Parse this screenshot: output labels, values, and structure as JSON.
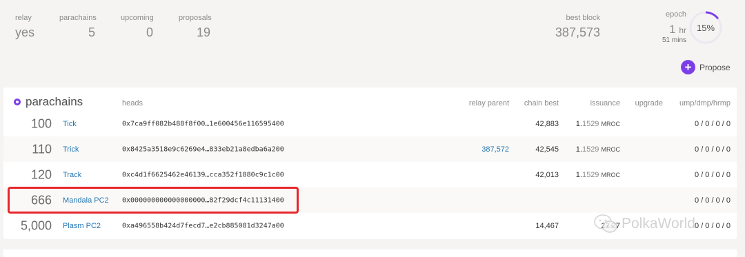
{
  "summary": {
    "relay": {
      "label": "relay",
      "value": "yes"
    },
    "parachains": {
      "label": "parachains",
      "value": "5"
    },
    "upcoming": {
      "label": "upcoming",
      "value": "0"
    },
    "proposals": {
      "label": "proposals",
      "value": "19"
    },
    "best_block": {
      "label": "best block",
      "value": "387,573"
    }
  },
  "epoch": {
    "label": "epoch",
    "hours": "1",
    "hours_unit": "hr",
    "minutes": "51 mins",
    "percent_label": "15%",
    "progress_fraction": 0.15
  },
  "propose_button": {
    "label": "Propose",
    "icon": "plus-icon"
  },
  "table": {
    "title": "parachains",
    "headers": {
      "heads": "heads",
      "relay_parent": "relay parent",
      "chain_best": "chain best",
      "issuance": "issuance",
      "upgrade": "upgrade",
      "ump": "ump/dmp/hrmp"
    },
    "rows": [
      {
        "id": "100",
        "name": "Tick",
        "head": "0x7ca9ff082b488f8f00…1e600456e116595400",
        "relay_parent": "",
        "chain_best": "42,883",
        "iss_int": "1.",
        "iss_frac": "1529",
        "iss_unit": "MROC",
        "ump": "0 / 0 / 0 / 0"
      },
      {
        "id": "110",
        "name": "Trick",
        "head": "0x8425a3518e9c6269e4…833eb21a8edba6a200",
        "relay_parent": "387,572",
        "chain_best": "42,545",
        "iss_int": "1.",
        "iss_frac": "1529",
        "iss_unit": "MROC",
        "ump": "0 / 0 / 0 / 0"
      },
      {
        "id": "120",
        "name": "Track",
        "head": "0xc4d1f6625462e46139…cca352f1880c9c1c00",
        "relay_parent": "",
        "chain_best": "42,013",
        "iss_int": "1.",
        "iss_frac": "1529",
        "iss_unit": "MROC",
        "ump": "0 / 0 / 0 / 0"
      },
      {
        "id": "666",
        "name": "Mandala PC2",
        "head": "0x000000000000000000…82f29dcf4c11131400",
        "relay_parent": "",
        "chain_best": "",
        "iss_int": "",
        "iss_frac": "",
        "iss_unit": "",
        "ump": "0 / 0 / 0 / 0"
      },
      {
        "id": "5,000",
        "name": "Plasm PC2",
        "head": "0xa496558b424d7fecd7…e2cb885081d3247a00",
        "relay_parent": "",
        "chain_best": "14,467",
        "iss_int": "22.27",
        "iss_frac": "",
        "iss_unit": "",
        "ump": "0 / 0 / 0 / 0"
      }
    ]
  },
  "watermark": {
    "text": "PolkaWorld",
    "icon": "wechat-icon"
  },
  "colors": {
    "accent": "#7c3ee8",
    "link": "#2477b3",
    "highlight": "#e6252a"
  }
}
